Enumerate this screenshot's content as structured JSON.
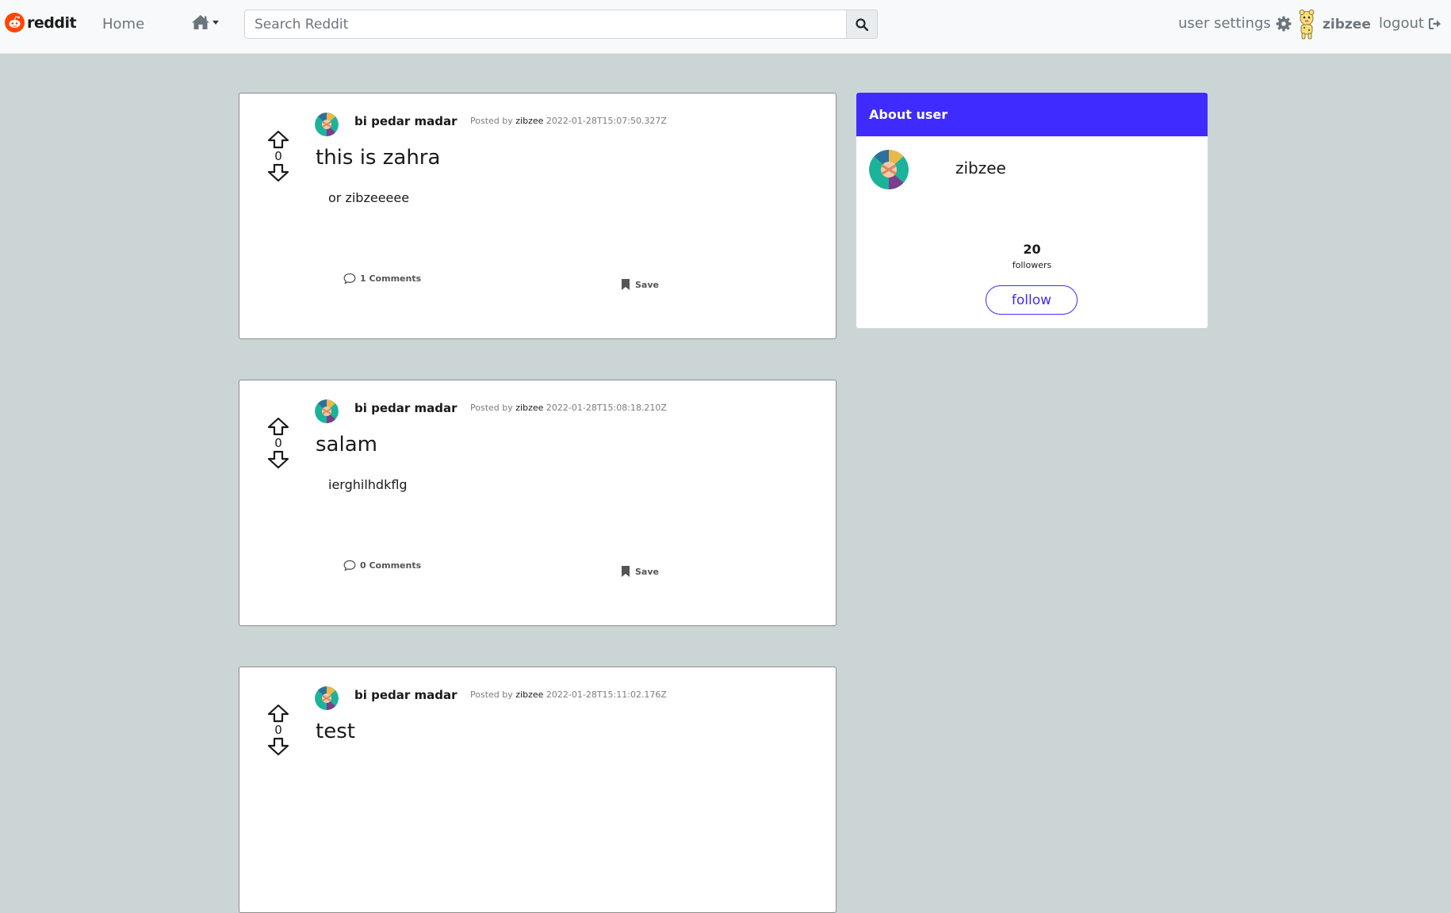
{
  "app": {
    "logo_text": "reddit"
  },
  "nav": {
    "home_label": "Home",
    "search_placeholder": "Search Reddit",
    "user_settings_label": "user settings",
    "username": "zibzee",
    "logout_label": "logout"
  },
  "posts": [
    {
      "subreddit": "bi pedar madar",
      "posted_by_prefix": "Posted by",
      "author": "zibzee",
      "timestamp": "2022-01-28T15:07:50.327Z",
      "title": "this is zahra",
      "body": "or zibzeeeee",
      "votes": "0",
      "comments_label": "1 Comments",
      "save_label": "Save"
    },
    {
      "subreddit": "bi pedar madar",
      "posted_by_prefix": "Posted by",
      "author": "zibzee",
      "timestamp": "2022-01-28T15:08:18.210Z",
      "title": "salam",
      "body": "ierghilhdkflg",
      "votes": "0",
      "comments_label": "0 Comments",
      "save_label": "Save"
    },
    {
      "subreddit": "bi pedar madar",
      "posted_by_prefix": "Posted by",
      "author": "zibzee",
      "timestamp": "2022-01-28T15:11:02.176Z",
      "title": "test",
      "body": "",
      "votes": "0",
      "comments_label": "",
      "save_label": ""
    }
  ],
  "about": {
    "title": "About user",
    "username": "zibzee",
    "followers_count": "20",
    "followers_label": "followers",
    "follow_label": "follow"
  },
  "colors": {
    "accent": "#3f2bff",
    "page_bg": "#cbd5d6",
    "logo": "#ff4500"
  }
}
